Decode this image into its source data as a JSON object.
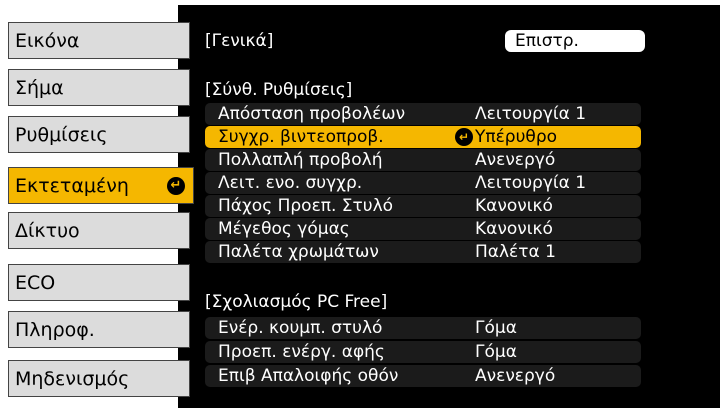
{
  "sidebar": {
    "items": [
      {
        "label": "Εικόνα"
      },
      {
        "label": "Σήμα"
      },
      {
        "label": "Ρυθμίσεις"
      },
      {
        "label": "Εκτεταμένη"
      },
      {
        "label": "Δίκτυο"
      },
      {
        "label": "ECO"
      },
      {
        "label": "Πληροφ."
      },
      {
        "label": "Μηδενισμός"
      }
    ],
    "active_index": 3
  },
  "main": {
    "general_label": "[Γενικά]",
    "back_button": "Επιστρ.",
    "section1": {
      "title": "[Σύνθ. Ρυθμίσεις]",
      "rows": [
        {
          "label": "Απόσταση προβολέων",
          "value": "Λειτουργία 1"
        },
        {
          "label": "Συγχρ. βιντεοπροβ.",
          "value": "Υπέρυθρο"
        },
        {
          "label": "Πολλαπλή προβολή",
          "value": "Ανενεργό"
        },
        {
          "label": "Λειτ. ενο. συγχρ.",
          "value": "Λειτουργία 1"
        },
        {
          "label": "Πάχος Προεπ. Στυλό",
          "value": "Κανονικό"
        },
        {
          "label": "Μέγεθος γόμας",
          "value": "Κανονικό"
        },
        {
          "label": "Παλέτα χρωμάτων",
          "value": "Παλέτα 1"
        }
      ]
    },
    "section2": {
      "title": "[Σχολιασμός PC Free]",
      "rows": [
        {
          "label": "Ενέρ. κουμπ. στυλό",
          "value": "Γόμα"
        },
        {
          "label": "Προεπ. ενέργ. αφής",
          "value": "Γόμα"
        },
        {
          "label": "Επιβ Απαλοιφής οθόν",
          "value": "Ανενεργό"
        }
      ]
    }
  },
  "colors": {
    "accent": "#f5b700",
    "panel": "#000000",
    "tab": "#dcdcdc"
  },
  "icons": {
    "enter": "enter-icon"
  }
}
